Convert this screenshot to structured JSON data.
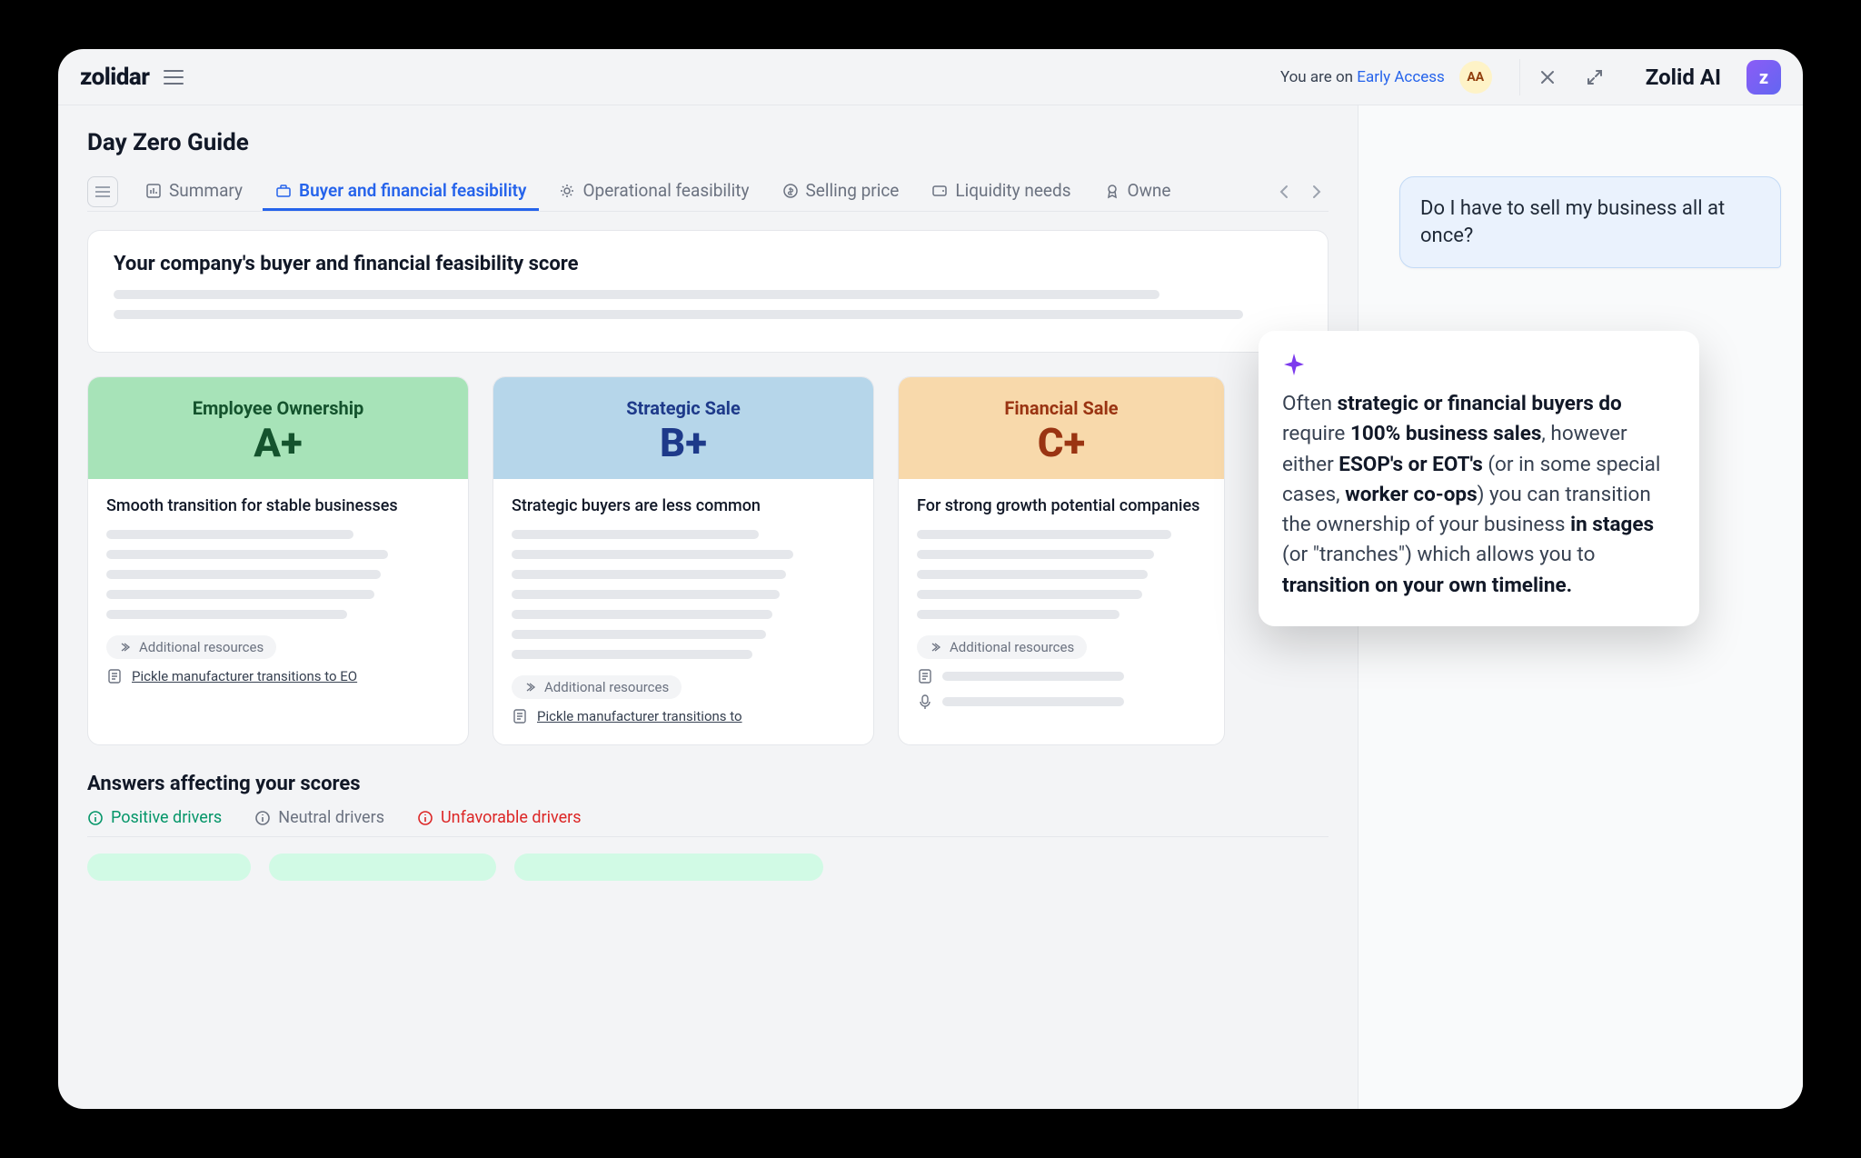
{
  "header": {
    "logo": "zolidar",
    "early_prefix": "You are on ",
    "early_link": "Early Access",
    "aa": "AA",
    "zolid_title": "Zolid AI",
    "ai_badge": "z"
  },
  "page": {
    "title": "Day Zero Guide"
  },
  "tabs": {
    "summary": "Summary",
    "buyer": "Buyer and financial feasibility",
    "operational": "Operational feasibility",
    "selling": "Selling price",
    "liquidity": "Liquidity needs",
    "ownership": "Owne"
  },
  "score_panel": {
    "heading": "Your company's buyer and financial feasibility score"
  },
  "cards": [
    {
      "title": "Employee Ownership",
      "grade": "A+",
      "sub": "Smooth transition for stable businesses",
      "resources_label": "Additional resources",
      "link": "Pickle manufacturer transitions to EO"
    },
    {
      "title": "Strategic Sale",
      "grade": "B+",
      "sub": "Strategic buyers are less common",
      "resources_label": "Additional resources",
      "link": "Pickle manufacturer transitions to"
    },
    {
      "title": "Financial Sale",
      "grade": "C+",
      "sub": "For strong growth potential companies",
      "resources_label": "Additional resources"
    }
  ],
  "answers": {
    "heading": "Answers affecting your scores",
    "positive": "Positive drivers",
    "neutral": "Neutral drivers",
    "unfavorable": "Unfavorable drivers"
  },
  "chat": {
    "user_q": "Do I have to sell my business all at once?",
    "ai": {
      "t1": "Often ",
      "b1": "strategic or financial buyers",
      "t2": " ",
      "b2": "do",
      "t3": " require ",
      "b3": "100% business sales",
      "t4": ", however either ",
      "b4": "ESOP's or EOT's",
      "t5": " (or in some special cases, ",
      "b5": "worker co-ops",
      "t6": ") you can transition the ownership of your business ",
      "b6": "in stages",
      "t7": " (or \"tranches\") which allows you to ",
      "b7": "transition on your own timeline.",
      "t8": ""
    }
  }
}
